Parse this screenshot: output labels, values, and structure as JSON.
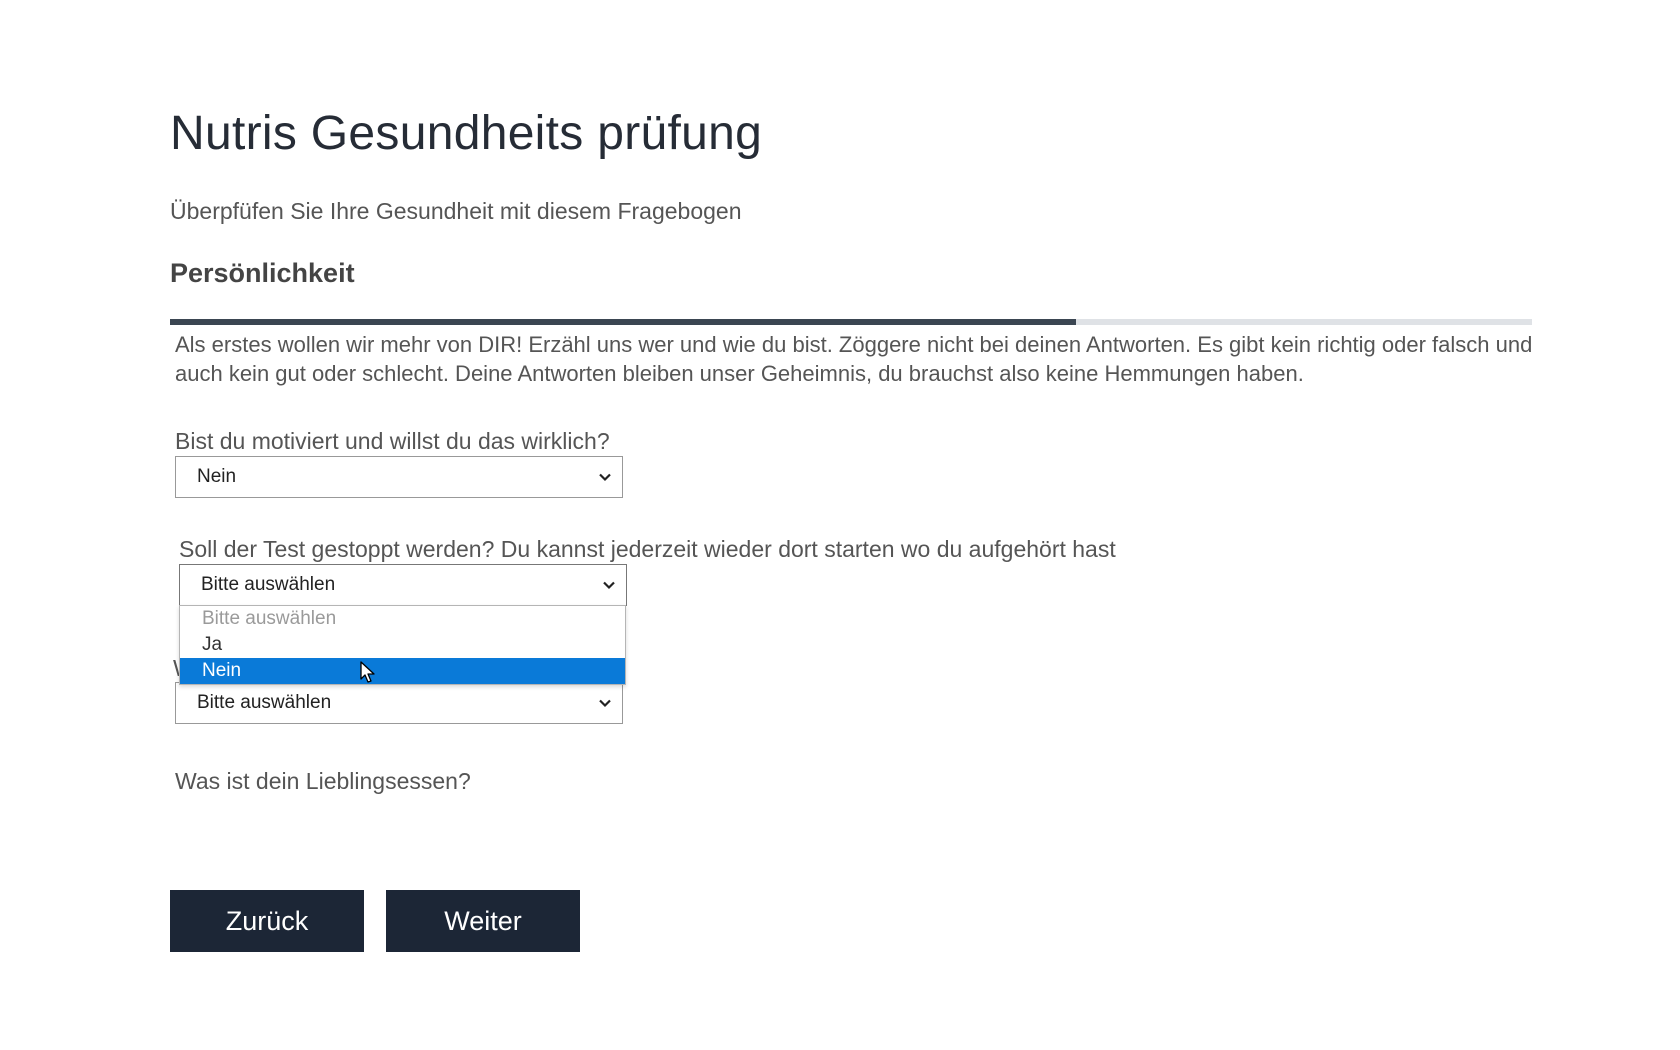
{
  "header": {
    "title": "Nutris Gesundheits prüfung",
    "subtitle": "Überpfüfen Sie Ihre Gesundheit mit diesem Fragebogen",
    "section": "Persönlichkeit"
  },
  "progress": {
    "fraction": 0.665
  },
  "intro": "Als erstes wollen wir mehr von DIR! Erzähl uns wer und wie du bist. Zöggere nicht bei deinen Antworten. Es gibt kein richtig oder falsch und auch kein gut oder schlecht. Deine Antworten bleiben unser Geheimnis, du brauchst also keine Hemmungen haben.",
  "questions": [
    {
      "label": "Bist du motiviert und willst du das wirklich?",
      "value": "Nein"
    },
    {
      "label": "Soll der Test gestoppt werden? Du kannst jederzeit wieder dort starten wo du aufgehört hast",
      "value": "Bitte auswählen"
    },
    {
      "label": "W",
      "value": "Bitte auswählen"
    },
    {
      "label": "Was ist dein Lieblingsessen?"
    }
  ],
  "dropdown": {
    "options": [
      "Bitte auswählen",
      "Ja",
      "Nein"
    ],
    "highlighted": "Nein"
  },
  "buttons": {
    "back": "Zurück",
    "next": "Weiter"
  },
  "colors": {
    "button_bg": "#1c2636",
    "highlight": "#0a7ad8",
    "progress_fill": "#3b4652"
  }
}
